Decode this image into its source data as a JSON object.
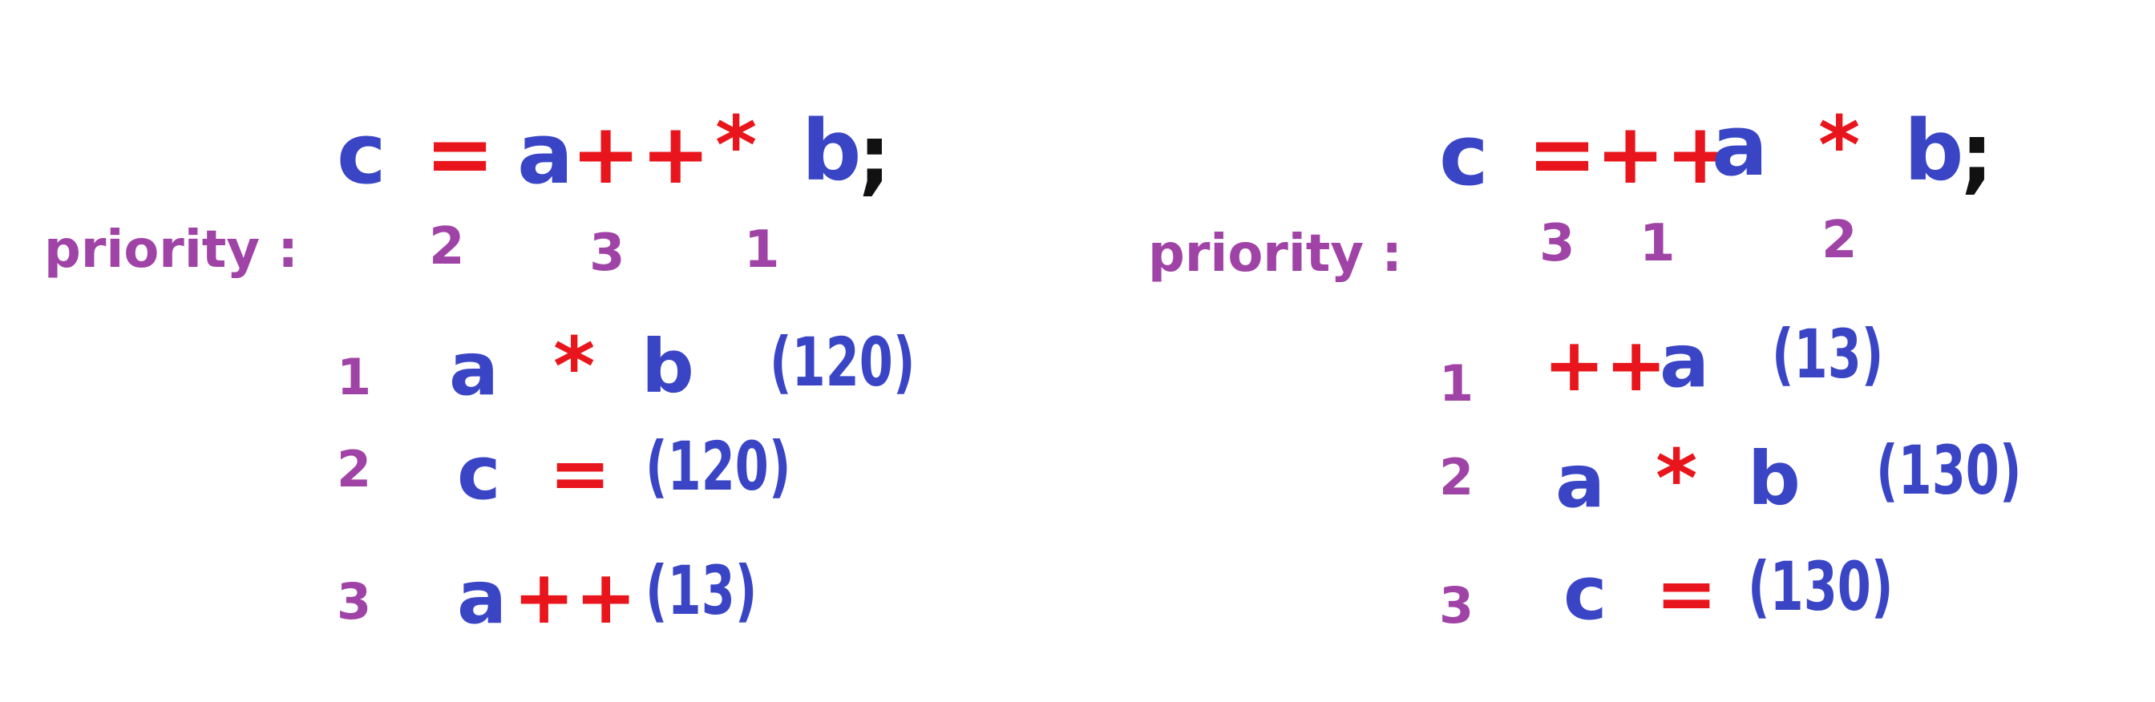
{
  "left": {
    "expr": {
      "c": "c",
      "eq": "=",
      "a": "a",
      "inc": "++",
      "mul": "*",
      "b": "b",
      "semi": ";"
    },
    "priority_label": "priority :",
    "priorities": {
      "eq": "2",
      "inc": "3",
      "mul": "1"
    },
    "steps": [
      {
        "num": "1",
        "var1": "a",
        "op": "*",
        "var2": "b",
        "result": "(120)"
      },
      {
        "num": "2",
        "var1": "c",
        "op": "=",
        "result": "(120)"
      },
      {
        "num": "3",
        "var1": "a",
        "op": "++",
        "result": "(13)"
      }
    ]
  },
  "right": {
    "expr": {
      "c": "c",
      "eq": "=",
      "inc": "++",
      "a": "a",
      "mul": "*",
      "b": "b",
      "semi": ";"
    },
    "priority_label": "priority :",
    "priorities": {
      "eq": "3",
      "inc": "1",
      "mul": "2"
    },
    "steps": [
      {
        "num": "1",
        "op": "++",
        "var1": "a",
        "result": "(13)"
      },
      {
        "num": "2",
        "var1": "a",
        "op": "*",
        "var2": "b",
        "result": "(130)"
      },
      {
        "num": "3",
        "var1": "c",
        "op": "=",
        "result": "(130)"
      }
    ]
  },
  "colors": {
    "variable": "#3a45c6",
    "operator": "#e8161c",
    "priority": "#a043a6",
    "semicolon": "#111111",
    "background": "#ffffff"
  }
}
